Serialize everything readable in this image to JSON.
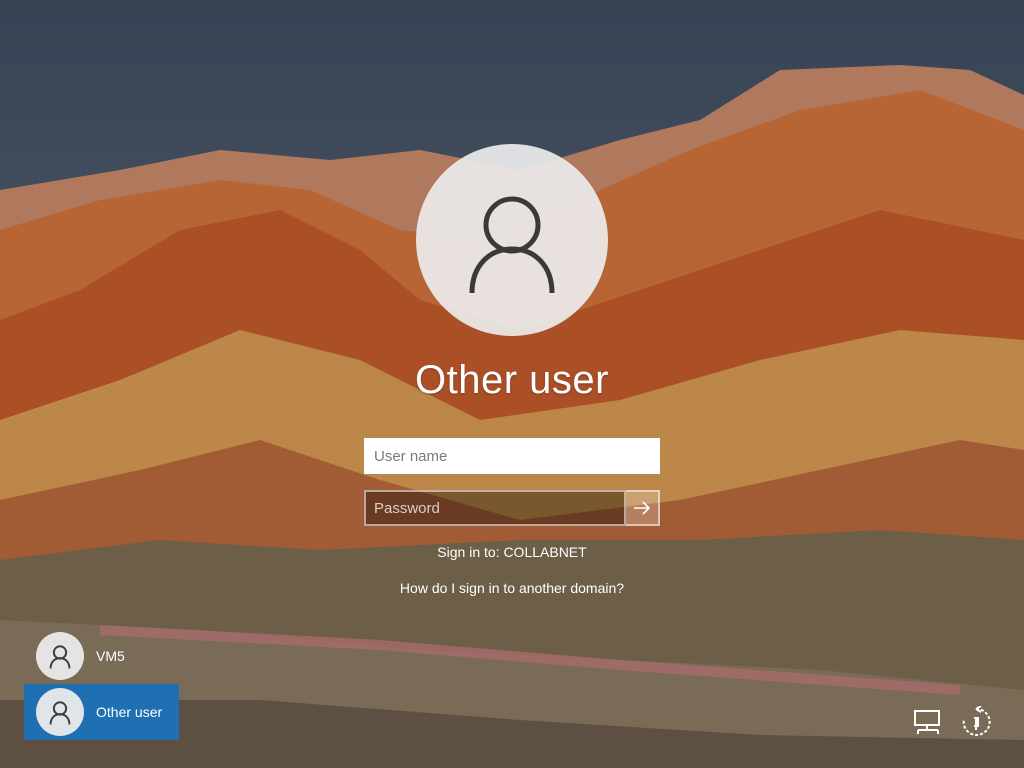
{
  "login": {
    "title": "Other user",
    "username_placeholder": "User name",
    "password_placeholder": "Password",
    "sign_in_to": "Sign in to: COLLABNET",
    "other_domain_link": "How do I sign in to another domain?"
  },
  "user_list": [
    {
      "label": "VM5",
      "selected": false
    },
    {
      "label": "Other user",
      "selected": true
    }
  ],
  "icons": {
    "network": "network-icon",
    "accessibility": "ease-of-access-icon",
    "avatar": "user-avatar-icon",
    "submit": "arrow-right-icon"
  },
  "colors": {
    "selected_tile": "#1f6fb3"
  }
}
